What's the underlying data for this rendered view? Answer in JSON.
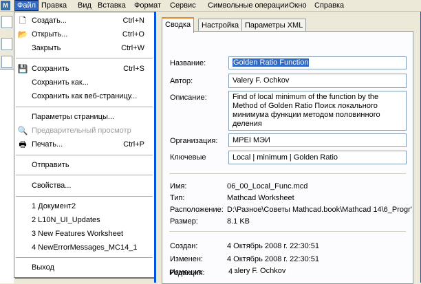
{
  "menubar": {
    "items": [
      "Файл",
      "Правка",
      "Вид",
      "Вставка",
      "Формат",
      "Сервис",
      "Символьные операции",
      "Окно",
      "Справка"
    ]
  },
  "file_menu": {
    "new": {
      "label": "Создать...",
      "shortcut": "Ctrl+N"
    },
    "open": {
      "label": "Открыть...",
      "shortcut": "Ctrl+O"
    },
    "close": {
      "label": "Закрыть",
      "shortcut": "Ctrl+W"
    },
    "save": {
      "label": "Сохранить",
      "shortcut": "Ctrl+S"
    },
    "save_as": {
      "label": "Сохранить как..."
    },
    "save_web": {
      "label": "Сохранить как веб-страницу..."
    },
    "page_setup": {
      "label": "Параметры страницы..."
    },
    "preview": {
      "label": "Предварительный просмотр"
    },
    "print": {
      "label": "Печать...",
      "shortcut": "Ctrl+P"
    },
    "send": {
      "label": "Отправить"
    },
    "properties": {
      "label": "Свойства..."
    },
    "recent": [
      "1 Документ2",
      "2 L10N_UI_Updates",
      "3 New Features Worksheet",
      "4 NewErrorMessages_MC14_1"
    ],
    "exit": {
      "label": "Выход"
    }
  },
  "dialog": {
    "tabs": [
      "Сводка",
      "Настройка",
      "Параметры XML"
    ],
    "summary": {
      "title_label": "Название:",
      "title_value": "Golden Ratio Function",
      "author_label": "Автор:",
      "author_value": "Valery F. Ochkov",
      "description_label": "Описание:",
      "description_value": "Find of local minimum of the function by the Method of Golden Ratio Поиск локального минимума функции методом половинного деления",
      "organization_label": "Организация:",
      "organization_value": "MPEI МЭИ",
      "keywords_label": "Ключевые",
      "keywords_value": "Local | minimum | Golden Ratio"
    },
    "info": {
      "name_label": "Имя:",
      "name_value": "06_00_Local_Func.mcd",
      "type_label": "Тип:",
      "type_value": "Mathcad Worksheet",
      "location_label": "Расположение:",
      "location_value": "D:\\Разное\\Советы Mathcad.book\\Mathcad 14\\6_Progr'",
      "size_label": "Размер:",
      "size_value": "8.1 KB"
    },
    "dates": {
      "created_label": "Создан:",
      "created_value": "4 Октябрь 2008 г. 22:30:51",
      "modified_label": "Изменен:",
      "modified_value": "4 Октябрь 2008 г. 22:30:51",
      "modified_by_label": "Изменил:",
      "modified_by_value": "Valery F. Ochkov",
      "revision_label": "Редакция:",
      "revision_value": "4"
    }
  }
}
